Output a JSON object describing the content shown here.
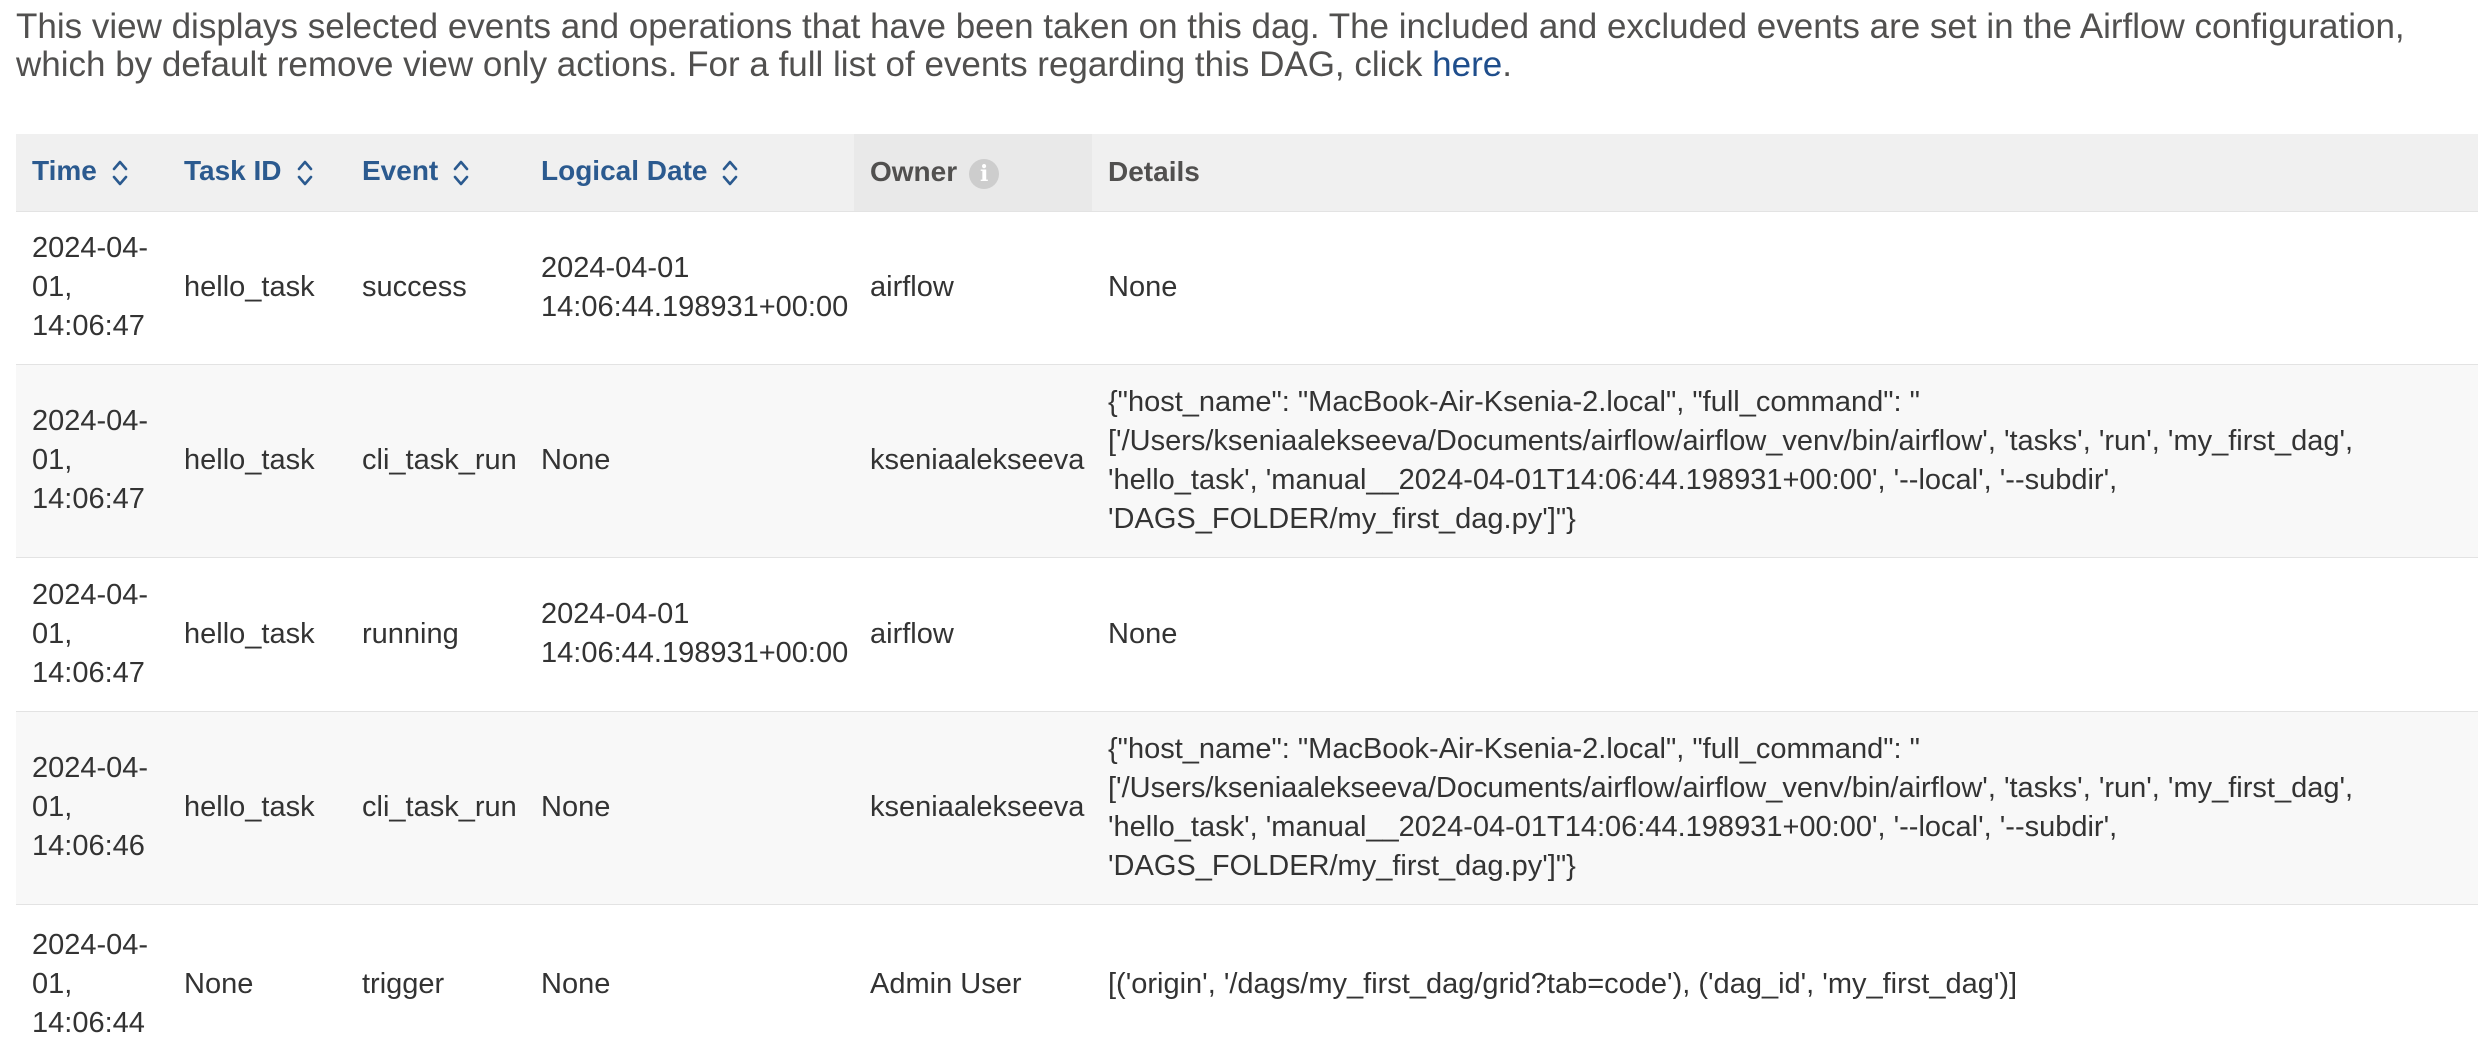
{
  "intro": {
    "text": "This view displays selected events and operations that have been taken on this dag. The included and excluded events are set in the Airflow configuration, which by default remove view only actions. For a full list of events regarding this DAG, click ",
    "link_text": "here",
    "end": "."
  },
  "table": {
    "headers": {
      "time": "Time",
      "task_id": "Task ID",
      "event": "Event",
      "logical_date": "Logical Date",
      "owner": "Owner",
      "details": "Details"
    },
    "rows": [
      {
        "time": "2024-04-\n01,\n14:06:47",
        "task_id": "hello_task",
        "event": "success",
        "logical_date": "2024-04-01\n14:06:44.198931+00:00",
        "owner": "airflow",
        "details": "None"
      },
      {
        "time": "2024-04-\n01,\n14:06:47",
        "task_id": "hello_task",
        "event": "cli_task_run",
        "logical_date": "None",
        "owner": "kseniaalekseeva",
        "details": "{\"host_name\": \"MacBook-Air-Ksenia-2.local\", \"full_command\": \"\n['/Users/kseniaalekseeva/Documents/airflow/airflow_venv/bin/airflow', 'tasks', 'run', 'my_first_dag',\n'hello_task', 'manual__2024-04-01T14:06:44.198931+00:00', '--local', '--subdir',\n'DAGS_FOLDER/my_first_dag.py']\"}"
      },
      {
        "time": "2024-04-\n01,\n14:06:47",
        "task_id": "hello_task",
        "event": "running",
        "logical_date": "2024-04-01\n14:06:44.198931+00:00",
        "owner": "airflow",
        "details": "None"
      },
      {
        "time": "2024-04-\n01,\n14:06:46",
        "task_id": "hello_task",
        "event": "cli_task_run",
        "logical_date": "None",
        "owner": "kseniaalekseeva",
        "details": "{\"host_name\": \"MacBook-Air-Ksenia-2.local\", \"full_command\": \"\n['/Users/kseniaalekseeva/Documents/airflow/airflow_venv/bin/airflow', 'tasks', 'run', 'my_first_dag',\n'hello_task', 'manual__2024-04-01T14:06:44.198931+00:00', '--local', '--subdir',\n'DAGS_FOLDER/my_first_dag.py']\"}"
      },
      {
        "time": "2024-04-\n01,\n14:06:44",
        "task_id": "None",
        "event": "trigger",
        "logical_date": "None",
        "owner": "Admin User",
        "details": "[('origin', '/dags/my_first_dag/grid?tab=code'), ('dag_id', 'my_first_dag')]"
      }
    ]
  },
  "icons": {
    "sort": "sort-up-down-icon",
    "info": "info-circle-icon"
  },
  "colors": {
    "link": "#1f4e8c",
    "sortable_header": "#2b5a8f",
    "header_bg": "#f0f0f0",
    "row_alt_bg": "#f8f8f8"
  }
}
